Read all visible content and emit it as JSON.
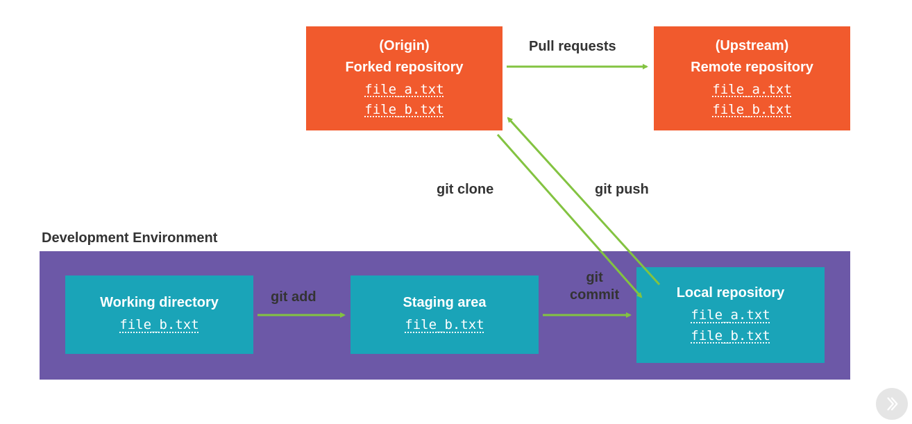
{
  "env_label": "Development Environment",
  "repos": {
    "origin": {
      "title1": "(Origin)",
      "title2": "Forked repository",
      "files": [
        "file_a.txt",
        "file_b.txt"
      ]
    },
    "upstream": {
      "title1": "(Upstream)",
      "title2": "Remote repository",
      "files": [
        "file_a.txt",
        "file_b.txt"
      ]
    }
  },
  "local": {
    "working": {
      "title": "Working directory",
      "files": [
        "file_b.txt"
      ]
    },
    "staging": {
      "title": "Staging area",
      "files": [
        "file_b.txt"
      ]
    },
    "localrepo": {
      "title": "Local repository",
      "files": [
        "file_a.txt",
        "file_b.txt"
      ]
    }
  },
  "arrows": {
    "pull_requests": "Pull requests",
    "git_clone": "git clone",
    "git_push": "git push",
    "git_add": "git add",
    "git_commit_l1": "git",
    "git_commit_l2": "commit"
  },
  "colors": {
    "arrow": "#83c341"
  }
}
